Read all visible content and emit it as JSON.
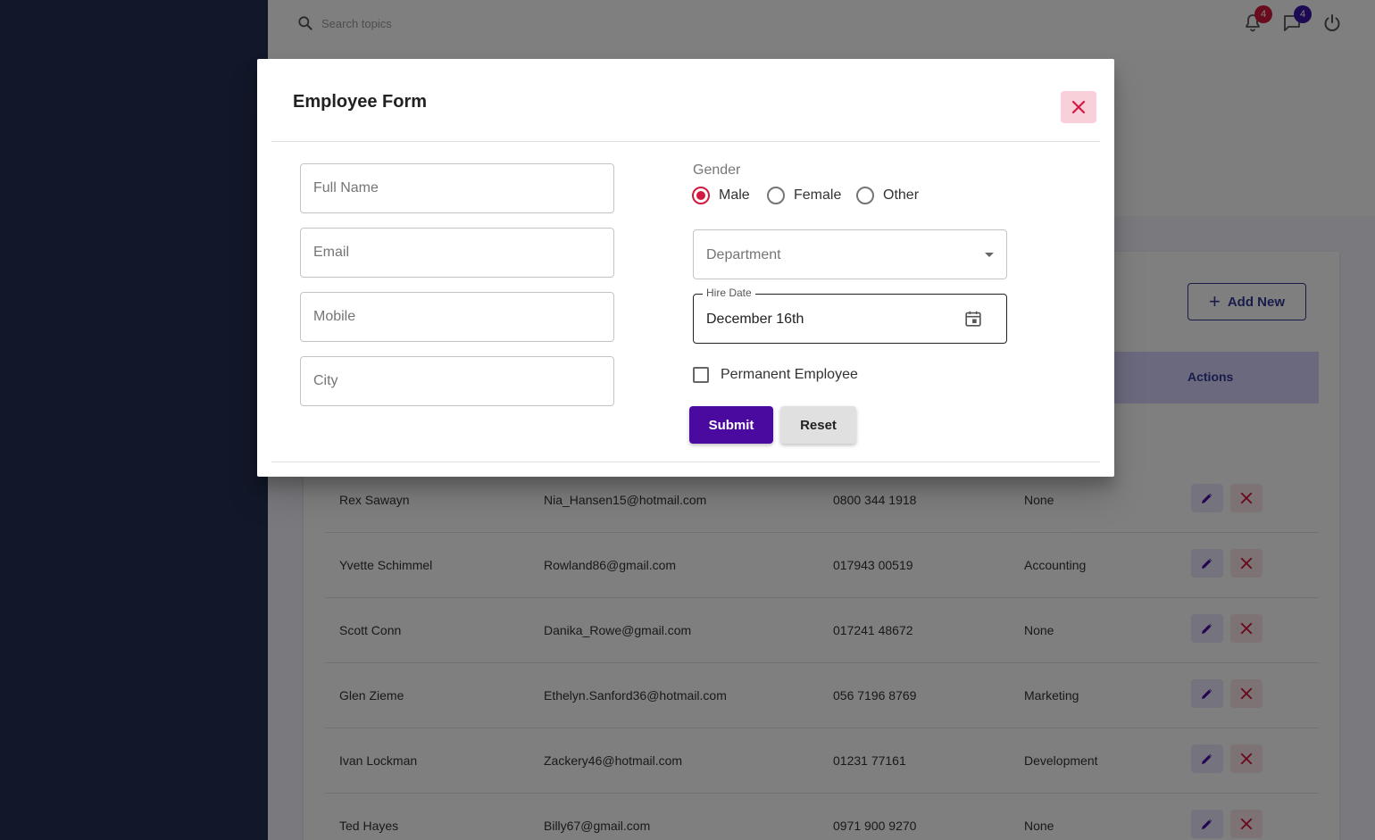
{
  "colors": {
    "sidebar": "#253053",
    "primary": "#4a0aa0",
    "secondary_red": "#d4183f",
    "table_header": "#d6d3fa"
  },
  "topbar": {
    "search_placeholder": "Search topics",
    "notifications_count": "4",
    "messages_count": "4"
  },
  "page": {
    "add_new_label": "Add New",
    "actions_header": "Actions"
  },
  "table": {
    "rows": [
      {
        "name": "Rex Sawayn",
        "email": "Nia_Hansen15@hotmail.com",
        "mobile": "0800 344 1918",
        "department": "None"
      },
      {
        "name": "Yvette Schimmel",
        "email": "Rowland86@gmail.com",
        "mobile": "017943 00519",
        "department": "Accounting"
      },
      {
        "name": "Scott Conn",
        "email": "Danika_Rowe@gmail.com",
        "mobile": "017241 48672",
        "department": "None"
      },
      {
        "name": "Glen Zieme",
        "email": "Ethelyn.Sanford36@hotmail.com",
        "mobile": "056 7196 8769",
        "department": "Marketing"
      },
      {
        "name": "Ivan Lockman",
        "email": "Zackery46@hotmail.com",
        "mobile": "01231 77161",
        "department": "Development"
      },
      {
        "name": "Ted Hayes",
        "email": "Billy67@gmail.com",
        "mobile": "0971 900 9270",
        "department": "None"
      }
    ]
  },
  "modal": {
    "title": "Employee Form",
    "fields": {
      "full_name": {
        "placeholder": "Full Name",
        "value": ""
      },
      "email": {
        "placeholder": "Email",
        "value": ""
      },
      "mobile": {
        "placeholder": "Mobile",
        "value": ""
      },
      "city": {
        "placeholder": "City",
        "value": ""
      }
    },
    "gender": {
      "label": "Gender",
      "options": [
        "Male",
        "Female",
        "Other"
      ],
      "selected": "Male"
    },
    "department": {
      "placeholder": "Department"
    },
    "hire_date": {
      "label": "Hire Date",
      "value": "December 16th"
    },
    "permanent": {
      "label": "Permanent Employee",
      "checked": false
    },
    "submit_label": "Submit",
    "reset_label": "Reset"
  }
}
